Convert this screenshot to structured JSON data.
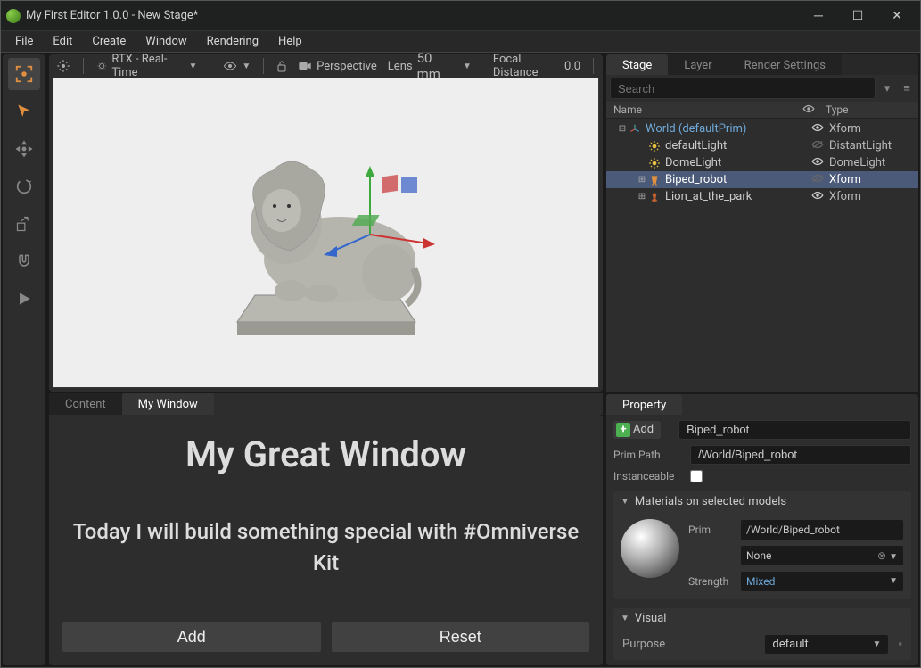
{
  "window": {
    "title": "My First Editor 1.0.0 - New Stage*"
  },
  "menu": {
    "file": "File",
    "edit": "Edit",
    "create": "Create",
    "window": "Window",
    "rendering": "Rendering",
    "help": "Help"
  },
  "viewport": {
    "renderer": "RTX - Real-Time",
    "camera": "Perspective",
    "lens_label": "Lens",
    "lens_value": "50 mm",
    "focal_label": "Focal Distance",
    "focal_value": "0.0"
  },
  "bottom_tabs": {
    "content": "Content",
    "mywin": "My Window"
  },
  "mywin": {
    "heading": "My Great Window",
    "sub": "Today I will build something special with #Omniverse Kit",
    "add": "Add",
    "reset": "Reset"
  },
  "stage_tabs": {
    "stage": "Stage",
    "layer": "Layer",
    "render": "Render Settings"
  },
  "search": {
    "placeholder": "Search"
  },
  "stage_header": {
    "name": "Name",
    "type": "Type"
  },
  "tree": [
    {
      "depth": 0,
      "toggle": "⊟",
      "icon": "axes",
      "label": "World (defaultPrim)",
      "eye": "visible",
      "type": "Xform",
      "color": "#6ea8d8"
    },
    {
      "depth": 1,
      "toggle": "",
      "icon": "light",
      "label": "defaultLight",
      "eye": "hidden",
      "type": "DistantLight",
      "color": "#cccccc"
    },
    {
      "depth": 1,
      "toggle": "",
      "icon": "light",
      "label": "DomeLight",
      "eye": "visible",
      "type": "DomeLight",
      "color": "#cccccc"
    },
    {
      "depth": 1,
      "toggle": "⊞",
      "icon": "robot",
      "label": "Biped_robot",
      "eye": "hidden",
      "type": "Xform",
      "color": "#ffffff",
      "selected": true
    },
    {
      "depth": 1,
      "toggle": "⊞",
      "icon": "mesh",
      "label": "Lion_at_the_park",
      "eye": "visible",
      "type": "Xform",
      "color": "#cccccc"
    }
  ],
  "property": {
    "tab": "Property",
    "add": "Add",
    "name_value": "Biped_robot",
    "primpath_label": "Prim Path",
    "primpath_value": "/World/Biped_robot",
    "instanceable_label": "Instanceable"
  },
  "materials": {
    "header": "Materials on selected models",
    "prim_label": "Prim",
    "prim_value": "/World/Biped_robot",
    "material_value": "None",
    "strength_label": "Strength",
    "strength_value": "Mixed"
  },
  "visual": {
    "header": "Visual",
    "purpose_label": "Purpose",
    "purpose_value": "default"
  }
}
